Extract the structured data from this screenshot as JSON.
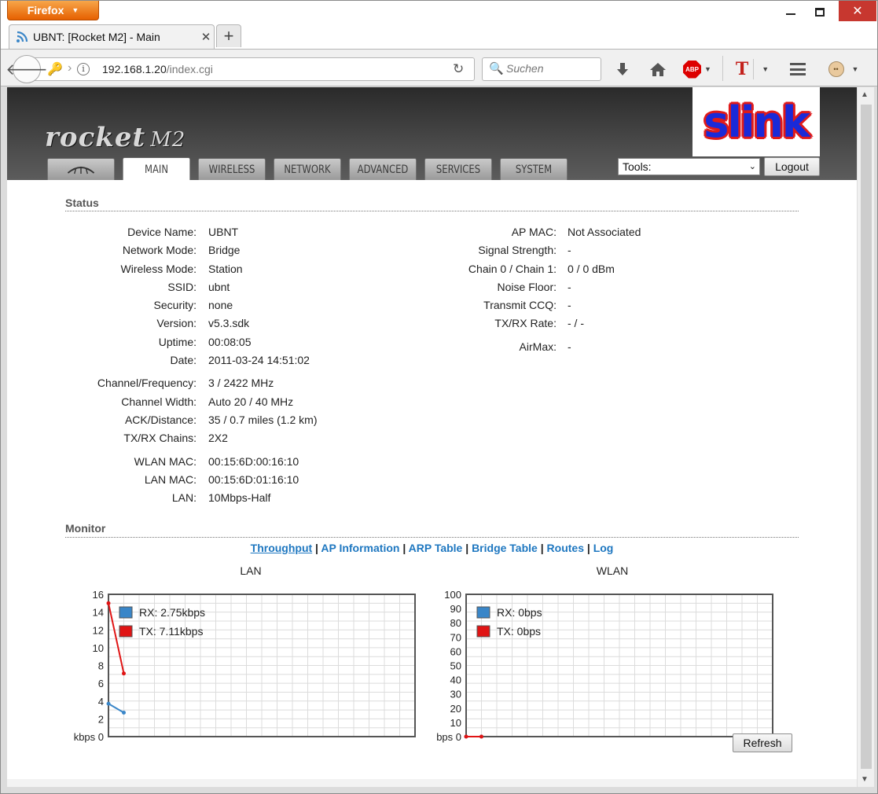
{
  "browser": {
    "app_button": "Firefox",
    "tab_title": "UBNT: [Rocket M2] - Main",
    "url_host": "192.168.1.20",
    "url_path": "/index.cgi",
    "search_placeholder": "Suchen",
    "abp_label": "ABP",
    "tt_label": "T",
    "icons": [
      "back-icon",
      "key-icon",
      "info-icon",
      "reload-icon",
      "search-icon",
      "download-icon",
      "home-icon",
      "adblock-icon",
      "menu-icon",
      "persona-icon"
    ]
  },
  "device_ui": {
    "logo": "rocket",
    "logo_model": "M2",
    "brand": "slink",
    "tabs": [
      {
        "label": "",
        "icon": "ubnt-logo-icon"
      },
      {
        "label": "MAIN",
        "active": true
      },
      {
        "label": "WIRELESS"
      },
      {
        "label": "NETWORK"
      },
      {
        "label": "ADVANCED"
      },
      {
        "label": "SERVICES"
      },
      {
        "label": "SYSTEM"
      }
    ],
    "tools_select": "Tools:",
    "logout_label": "Logout"
  },
  "status": {
    "title": "Status",
    "left": [
      {
        "k": "Device Name:",
        "v": "UBNT"
      },
      {
        "k": "Network Mode:",
        "v": "Bridge"
      },
      {
        "k": "Wireless Mode:",
        "v": "Station"
      },
      {
        "k": "SSID:",
        "v": "ubnt"
      },
      {
        "k": "Security:",
        "v": "none"
      },
      {
        "k": "Version:",
        "v": "v5.3.sdk"
      },
      {
        "k": "Uptime:",
        "v": "00:08:05"
      },
      {
        "k": "Date:",
        "v": "2011-03-24 14:51:02"
      },
      {
        "k": "Channel/Frequency:",
        "v": "3 / 2422 MHz"
      },
      {
        "k": "Channel Width:",
        "v": "Auto 20 / 40 MHz"
      },
      {
        "k": "ACK/Distance:",
        "v": "35 / 0.7 miles (1.2 km)"
      },
      {
        "k": "TX/RX Chains:",
        "v": "2X2"
      },
      {
        "k": "WLAN MAC:",
        "v": "00:15:6D:00:16:10"
      },
      {
        "k": "LAN MAC:",
        "v": "00:15:6D:01:16:10"
      },
      {
        "k": "LAN:",
        "v": "10Mbps-Half"
      }
    ],
    "right": [
      {
        "k": "AP MAC:",
        "v": "Not Associated"
      },
      {
        "k": "Signal Strength:",
        "v": "-"
      },
      {
        "k": "Chain 0 / Chain 1:",
        "v": "0 / 0 dBm"
      },
      {
        "k": "Noise Floor:",
        "v": "-"
      },
      {
        "k": "Transmit CCQ:",
        "v": "-"
      },
      {
        "k": "TX/RX Rate:",
        "v": "- / -"
      },
      {
        "k": "AirMax:",
        "v": "-"
      }
    ]
  },
  "monitor": {
    "title": "Monitor",
    "links": [
      "Throughput",
      "AP Information",
      "ARP Table",
      "Bridge Table",
      "Routes",
      "Log"
    ],
    "active_link": "Throughput",
    "refresh_label": "Refresh"
  },
  "chart_data": [
    {
      "type": "line",
      "title": "LAN",
      "ylabel": "kbps",
      "ylim": [
        0,
        16
      ],
      "yticks": [
        0,
        2,
        4,
        6,
        8,
        10,
        12,
        14,
        16
      ],
      "legend_position": "top-left",
      "series": [
        {
          "name": "RX: 2.75kbps",
          "color": "#3a86c8",
          "values": [
            3.7,
            2.7
          ]
        },
        {
          "name": "TX: 7.11kbps",
          "color": "#e01414",
          "values": [
            15,
            7.1
          ]
        }
      ]
    },
    {
      "type": "line",
      "title": "WLAN",
      "ylabel": "bps",
      "ylim": [
        0,
        100
      ],
      "yticks": [
        0,
        10,
        20,
        30,
        40,
        50,
        60,
        70,
        80,
        90,
        100
      ],
      "legend_position": "top-left",
      "series": [
        {
          "name": "RX: 0bps",
          "color": "#3a86c8",
          "values": [
            0,
            0
          ]
        },
        {
          "name": "TX: 0bps",
          "color": "#e01414",
          "values": [
            0,
            0
          ]
        }
      ]
    }
  ]
}
